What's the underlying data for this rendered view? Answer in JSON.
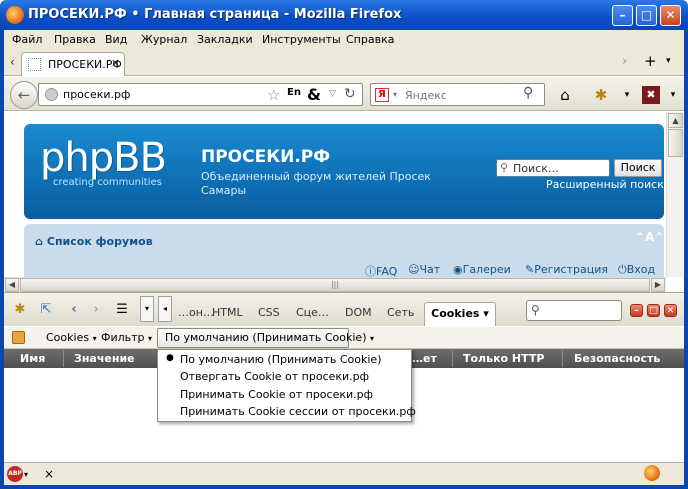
{
  "window": {
    "title": "ПРОСЕКИ.РФ • Главная страница - Mozilla Firefox"
  },
  "menu": [
    "Файл",
    "Правка",
    "Вид",
    "Журнал",
    "Закладки",
    "Инструменты",
    "Справка"
  ],
  "tabs": [
    {
      "label": "ПРОСЕКИ.РФ"
    }
  ],
  "urlbar": {
    "value": "просеки.рф",
    "lang_badge": "En"
  },
  "searchbar": {
    "engine_glyph": "Я",
    "placeholder": "Яндекс"
  },
  "page": {
    "logo_text": "phpBB",
    "logo_sub": "creating   communities",
    "site_name": "ПРОСЕКИ.РФ",
    "site_desc": "Объединенный форум жителей Просек Самары",
    "search_placeholder": "Поиск…",
    "search_button": "Поиск",
    "advanced_search": "Расширенный поиск",
    "forum_list": "Список форумов",
    "font_size_glyph": "⌃A⌃",
    "nav_links": [
      "FAQ",
      "Чат",
      "Галереи",
      "Регистрация",
      "Вход"
    ]
  },
  "firebug": {
    "tabs": [
      "…он…",
      "HTML",
      "CSS",
      "Сце…",
      "DOM",
      "Сеть"
    ],
    "active_tab": "Cookies ▾",
    "cookie_toolbar": {
      "cookies": "Cookies",
      "filter": "Фильтр",
      "policy": "По умолчанию (Принимать Cookie)"
    },
    "columns": [
      "Имя",
      "Значение",
      "…ет",
      "Только HTTP",
      "Безопасность"
    ],
    "policy_options": [
      "По умолчанию (Принимать Cookie)",
      "Отвергать Cookie от просеки.рф",
      "Принимать Cookie от просеки.рф",
      "Принимать Cookie сессии от просеки.рф"
    ]
  },
  "statusbar": {
    "close_glyph": "×"
  }
}
